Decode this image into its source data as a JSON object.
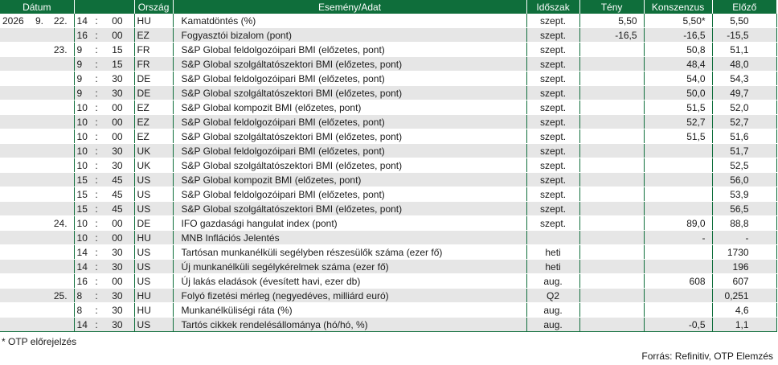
{
  "headers": {
    "date": "Dátum",
    "country": "Ország",
    "event": "Esemény/Adat",
    "period": "Időszak",
    "actual": "Tény",
    "consensus": "Konszenzus",
    "previous": "Előző"
  },
  "rows": [
    {
      "year": "2026",
      "month": "9.",
      "day": "22.",
      "hh": "14",
      "sep": ":",
      "mm": "00",
      "country": "HU",
      "event": "Kamatdöntés (%)",
      "period": "szept.",
      "actual": "5,50",
      "consensus": "5,50*",
      "previous": "5,50"
    },
    {
      "year": "",
      "month": "",
      "day": "",
      "hh": "16",
      "sep": ":",
      "mm": "00",
      "country": "EZ",
      "event": "Fogyasztói bizalom (pont)",
      "period": "szept.",
      "actual": "-16,5",
      "consensus": "-16,5",
      "previous": "-15,5"
    },
    {
      "year": "",
      "month": "",
      "day": "23.",
      "hh": "9",
      "sep": ":",
      "mm": "15",
      "country": "FR",
      "event": "S&P Global feldolgozóipari BMI (előzetes, pont)",
      "period": "szept.",
      "actual": "",
      "consensus": "50,8",
      "previous": "51,1"
    },
    {
      "year": "",
      "month": "",
      "day": "",
      "hh": "9",
      "sep": ":",
      "mm": "15",
      "country": "FR",
      "event": "S&P Global szolgáltatószektori BMI (előzetes, pont)",
      "period": "szept.",
      "actual": "",
      "consensus": "48,4",
      "previous": "48,0"
    },
    {
      "year": "",
      "month": "",
      "day": "",
      "hh": "9",
      "sep": ":",
      "mm": "30",
      "country": "DE",
      "event": "S&P Global feldolgozóipari BMI (előzetes, pont)",
      "period": "szept.",
      "actual": "",
      "consensus": "54,0",
      "previous": "54,3"
    },
    {
      "year": "",
      "month": "",
      "day": "",
      "hh": "9",
      "sep": ":",
      "mm": "30",
      "country": "DE",
      "event": "S&P Global szolgáltatószektori BMI (előzetes, pont)",
      "period": "szept.",
      "actual": "",
      "consensus": "50,0",
      "previous": "49,7"
    },
    {
      "year": "",
      "month": "",
      "day": "",
      "hh": "10",
      "sep": ":",
      "mm": "00",
      "country": "EZ",
      "event": "S&P Global kompozit BMI (előzetes, pont)",
      "period": "szept.",
      "actual": "",
      "consensus": "51,5",
      "previous": "52,0"
    },
    {
      "year": "",
      "month": "",
      "day": "",
      "hh": "10",
      "sep": ":",
      "mm": "00",
      "country": "EZ",
      "event": "S&P Global feldolgozóipari BMI (előzetes, pont)",
      "period": "szept.",
      "actual": "",
      "consensus": "52,7",
      "previous": "52,7"
    },
    {
      "year": "",
      "month": "",
      "day": "",
      "hh": "10",
      "sep": ":",
      "mm": "00",
      "country": "EZ",
      "event": "S&P Global szolgáltatószektori BMI (előzetes, pont)",
      "period": "szept.",
      "actual": "",
      "consensus": "51,5",
      "previous": "51,6"
    },
    {
      "year": "",
      "month": "",
      "day": "",
      "hh": "10",
      "sep": ":",
      "mm": "30",
      "country": "UK",
      "event": "S&P Global feldolgozóipari BMI (előzetes, pont)",
      "period": "szept.",
      "actual": "",
      "consensus": "",
      "previous": "51,7"
    },
    {
      "year": "",
      "month": "",
      "day": "",
      "hh": "10",
      "sep": ":",
      "mm": "30",
      "country": "UK",
      "event": "S&P Global szolgáltatószektori BMI (előzetes, pont)",
      "period": "szept.",
      "actual": "",
      "consensus": "",
      "previous": "52,5"
    },
    {
      "year": "",
      "month": "",
      "day": "",
      "hh": "15",
      "sep": ":",
      "mm": "45",
      "country": "US",
      "event": "S&P Global kompozit BMI (előzetes, pont)",
      "period": "szept.",
      "actual": "",
      "consensus": "",
      "previous": "56,0"
    },
    {
      "year": "",
      "month": "",
      "day": "",
      "hh": "15",
      "sep": ":",
      "mm": "45",
      "country": "US",
      "event": "S&P Global feldolgozóipari BMI (előzetes, pont)",
      "period": "szept.",
      "actual": "",
      "consensus": "",
      "previous": "53,9"
    },
    {
      "year": "",
      "month": "",
      "day": "",
      "hh": "15",
      "sep": ":",
      "mm": "45",
      "country": "US",
      "event": "S&P Global szolgáltatószektori BMI (előzetes, pont)",
      "period": "szept.",
      "actual": "",
      "consensus": "",
      "previous": "56,5"
    },
    {
      "year": "",
      "month": "",
      "day": "24.",
      "hh": "10",
      "sep": ":",
      "mm": "00",
      "country": "DE",
      "event": "IFO gazdasági hangulat index (pont)",
      "period": "szept.",
      "actual": "",
      "consensus": "89,0",
      "previous": "88,8"
    },
    {
      "year": "",
      "month": "",
      "day": "",
      "hh": "10",
      "sep": ":",
      "mm": "00",
      "country": "HU",
      "event": "MNB Inflációs Jelentés",
      "period": "",
      "actual": "",
      "consensus": "-",
      "previous": "-"
    },
    {
      "year": "",
      "month": "",
      "day": "",
      "hh": "14",
      "sep": ":",
      "mm": "30",
      "country": "US",
      "event": "Tartósan munkanélküli segélyben részesülők száma (ezer fő)",
      "period": "heti",
      "actual": "",
      "consensus": "",
      "previous": "1730"
    },
    {
      "year": "",
      "month": "",
      "day": "",
      "hh": "14",
      "sep": ":",
      "mm": "30",
      "country": "US",
      "event": "Új munkanélküli segélykérelmek száma (ezer fő)",
      "period": "heti",
      "actual": "",
      "consensus": "",
      "previous": "196"
    },
    {
      "year": "",
      "month": "",
      "day": "",
      "hh": "16",
      "sep": ":",
      "mm": "00",
      "country": "US",
      "event": "Új lakás eladások (évesített havi, ezer db)",
      "period": "aug.",
      "actual": "",
      "consensus": "608",
      "previous": "607"
    },
    {
      "year": "",
      "month": "",
      "day": "25.",
      "hh": "8",
      "sep": ":",
      "mm": "30",
      "country": "HU",
      "event": "Folyó fizetési mérleg (negyedéves, milliárd euró)",
      "period": "Q2",
      "actual": "",
      "consensus": "",
      "previous": "0,251"
    },
    {
      "year": "",
      "month": "",
      "day": "",
      "hh": "8",
      "sep": ":",
      "mm": "30",
      "country": "HU",
      "event": "Munkanélküliségi ráta (%)",
      "period": "aug.",
      "actual": "",
      "consensus": "",
      "previous": "4,6"
    },
    {
      "year": "",
      "month": "",
      "day": "",
      "hh": "14",
      "sep": ":",
      "mm": "30",
      "country": "US",
      "event": "Tartós cikkek rendelésállománya (hó/hó, %)",
      "period": "aug.",
      "actual": "",
      "consensus": "-0,5",
      "previous": "1,1"
    }
  ],
  "footnote": "* OTP előrejelzés",
  "source": "Forrás: Refinitiv, OTP Elemzés",
  "colors": {
    "header_bg": "#0f6e3b",
    "stripe": "#e6e6e6"
  }
}
